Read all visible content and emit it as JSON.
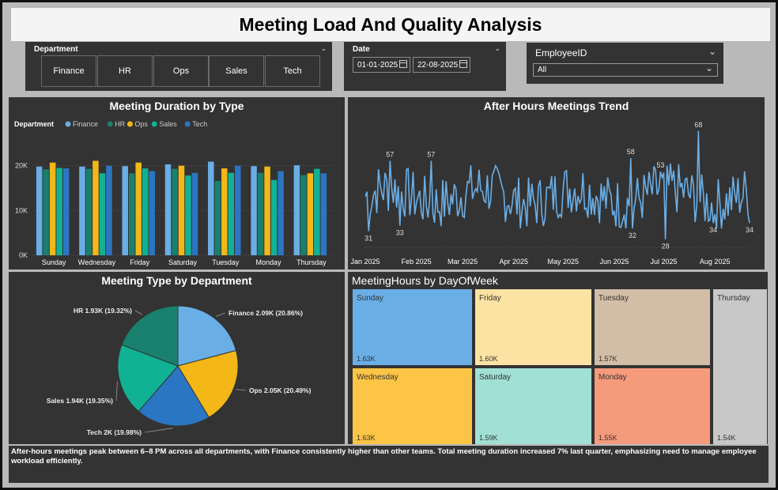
{
  "page_title": "Meeting Load And Quality Analysis",
  "slicers": {
    "department": {
      "title": "Department",
      "options": [
        "Finance",
        "HR",
        "Ops",
        "Sales",
        "Tech"
      ]
    },
    "date": {
      "title": "Date",
      "start": "01-01-2025",
      "end": "22-08-2025"
    },
    "employee": {
      "title": "EmployeeID",
      "value": "All"
    }
  },
  "colors": {
    "Finance": "#6aaee6",
    "HR": "#19806d",
    "Ops": "#f3b718",
    "Sales": "#11b294",
    "Tech": "#2b76c2"
  },
  "duration_chart": {
    "chart_data": {
      "type": "bar",
      "title": "Meeting Duration by Type",
      "legend_title": "Department",
      "categories": [
        "Sunday",
        "Wednesday",
        "Friday",
        "Saturday",
        "Tuesday",
        "Monday",
        "Thursday"
      ],
      "series": [
        {
          "name": "Finance",
          "values": [
            19800,
            19800,
            19900,
            20300,
            20900,
            19900,
            20100
          ]
        },
        {
          "name": "HR",
          "values": [
            19200,
            19300,
            18300,
            19300,
            16600,
            18400,
            17900
          ]
        },
        {
          "name": "Ops",
          "values": [
            20700,
            21100,
            20700,
            20000,
            19400,
            19800,
            18300
          ]
        },
        {
          "name": "Sales",
          "values": [
            19500,
            18300,
            19400,
            17800,
            18400,
            16800,
            19300
          ]
        },
        {
          "name": "Tech",
          "values": [
            19400,
            20000,
            18800,
            18400,
            20000,
            18800,
            18300
          ]
        }
      ],
      "yticks": [
        "0K",
        "10K",
        "20K"
      ],
      "ylim": [
        0,
        24000
      ]
    }
  },
  "afterhours_chart": {
    "chart_data": {
      "type": "line",
      "title": "After Hours Meetings Trend",
      "xticks": [
        "Jan 2025",
        "Feb 2025",
        "Mar 2025",
        "Apr 2025",
        "May 2025",
        "Jun 2025",
        "Jul 2025",
        "Aug 2025"
      ],
      "xlim": [
        "2025-01-01",
        "2025-08-22"
      ],
      "ylim": [
        25,
        70
      ],
      "data_labels": [
        {
          "date": "2025-01-03",
          "value": 31,
          "label": "31"
        },
        {
          "date": "2025-01-16",
          "value": 57,
          "label": "57"
        },
        {
          "date": "2025-01-22",
          "value": 33,
          "label": "33"
        },
        {
          "date": "2025-02-10",
          "value": 57,
          "label": "57"
        },
        {
          "date": "2025-06-11",
          "value": 58,
          "label": "58"
        },
        {
          "date": "2025-06-12",
          "value": 32,
          "label": "32"
        },
        {
          "date": "2025-06-29",
          "value": 53,
          "label": "53"
        },
        {
          "date": "2025-07-02",
          "value": 28,
          "label": "28"
        },
        {
          "date": "2025-07-22",
          "value": 68,
          "label": "68"
        },
        {
          "date": "2025-07-31",
          "value": 34,
          "label": "34"
        },
        {
          "date": "2025-08-22",
          "value": 34,
          "label": "34"
        }
      ]
    }
  },
  "pie_chart": {
    "chart_data": {
      "type": "pie",
      "title": "Meeting Type by Department",
      "slices": [
        {
          "name": "Finance",
          "value": 2090,
          "label": "Finance 2.09K (20.86%)"
        },
        {
          "name": "Ops",
          "value": 2050,
          "label": "Ops 2.05K (20.49%)"
        },
        {
          "name": "Tech",
          "value": 2000,
          "label": "Tech 2K (19.98%)"
        },
        {
          "name": "Sales",
          "value": 1940,
          "label": "Sales 1.94K (19.35%)"
        },
        {
          "name": "HR",
          "value": 1930,
          "label": "HR 1.93K (19.32%)"
        }
      ]
    }
  },
  "treemap": {
    "title": "MeetingHours by DayOfWeek",
    "chart_data": {
      "type": "treemap",
      "items": [
        {
          "name": "Sunday",
          "value": 1630,
          "label": "1.63K",
          "color": "#6aaee6"
        },
        {
          "name": "Wednesday",
          "value": 1630,
          "label": "1.63K",
          "color": "#fcc546"
        },
        {
          "name": "Friday",
          "value": 1600,
          "label": "1.60K",
          "color": "#fde3a3"
        },
        {
          "name": "Saturday",
          "value": 1590,
          "label": "1.59K",
          "color": "#a1e0d4"
        },
        {
          "name": "Tuesday",
          "value": 1570,
          "label": "1.57K",
          "color": "#d2bda6"
        },
        {
          "name": "Monday",
          "value": 1550,
          "label": "1.55K",
          "color": "#f69a7c"
        },
        {
          "name": "Thursday",
          "value": 1540,
          "label": "1.54K",
          "color": "#c8c8c8"
        }
      ]
    }
  },
  "insight_note": "After-hours meetings peak between 6–8 PM across all departments, with Finance consistently higher than other teams. Total meeting duration increased 7% last quarter, emphasizing need to manage employee workload efficiently."
}
